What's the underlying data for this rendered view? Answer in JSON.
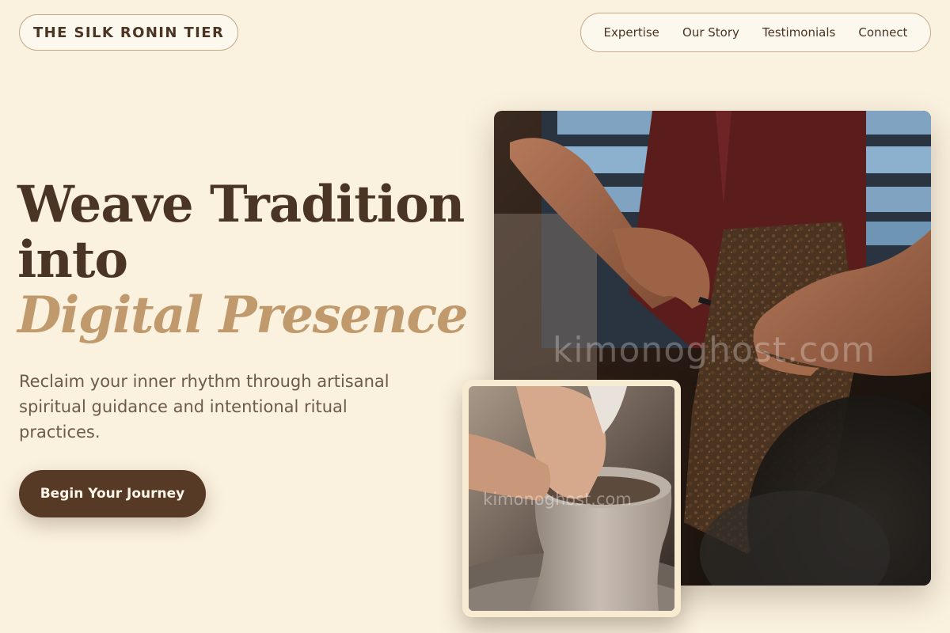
{
  "brand": {
    "name": "THE SILK RONIN TIER"
  },
  "nav": {
    "items": [
      "Expertise",
      "Our Story",
      "Testimonials",
      "Connect"
    ]
  },
  "hero": {
    "headline_line1": "Weave Tradition",
    "headline_line2": "into",
    "headline_accent": "Digital Presence",
    "subtitle": "Reclaim your inner rhythm through artisanal spiritual guidance and intentional ritual practices.",
    "cta_label": "Begin Your Journey"
  },
  "images": {
    "main_watermark": "kimonoghost.com",
    "inset_watermark": "kimonoghost.com"
  },
  "colors": {
    "background": "#faf1de",
    "primary_dark": "#4a3424",
    "accent_gold": "#c09a6c",
    "button": "#563a26"
  }
}
